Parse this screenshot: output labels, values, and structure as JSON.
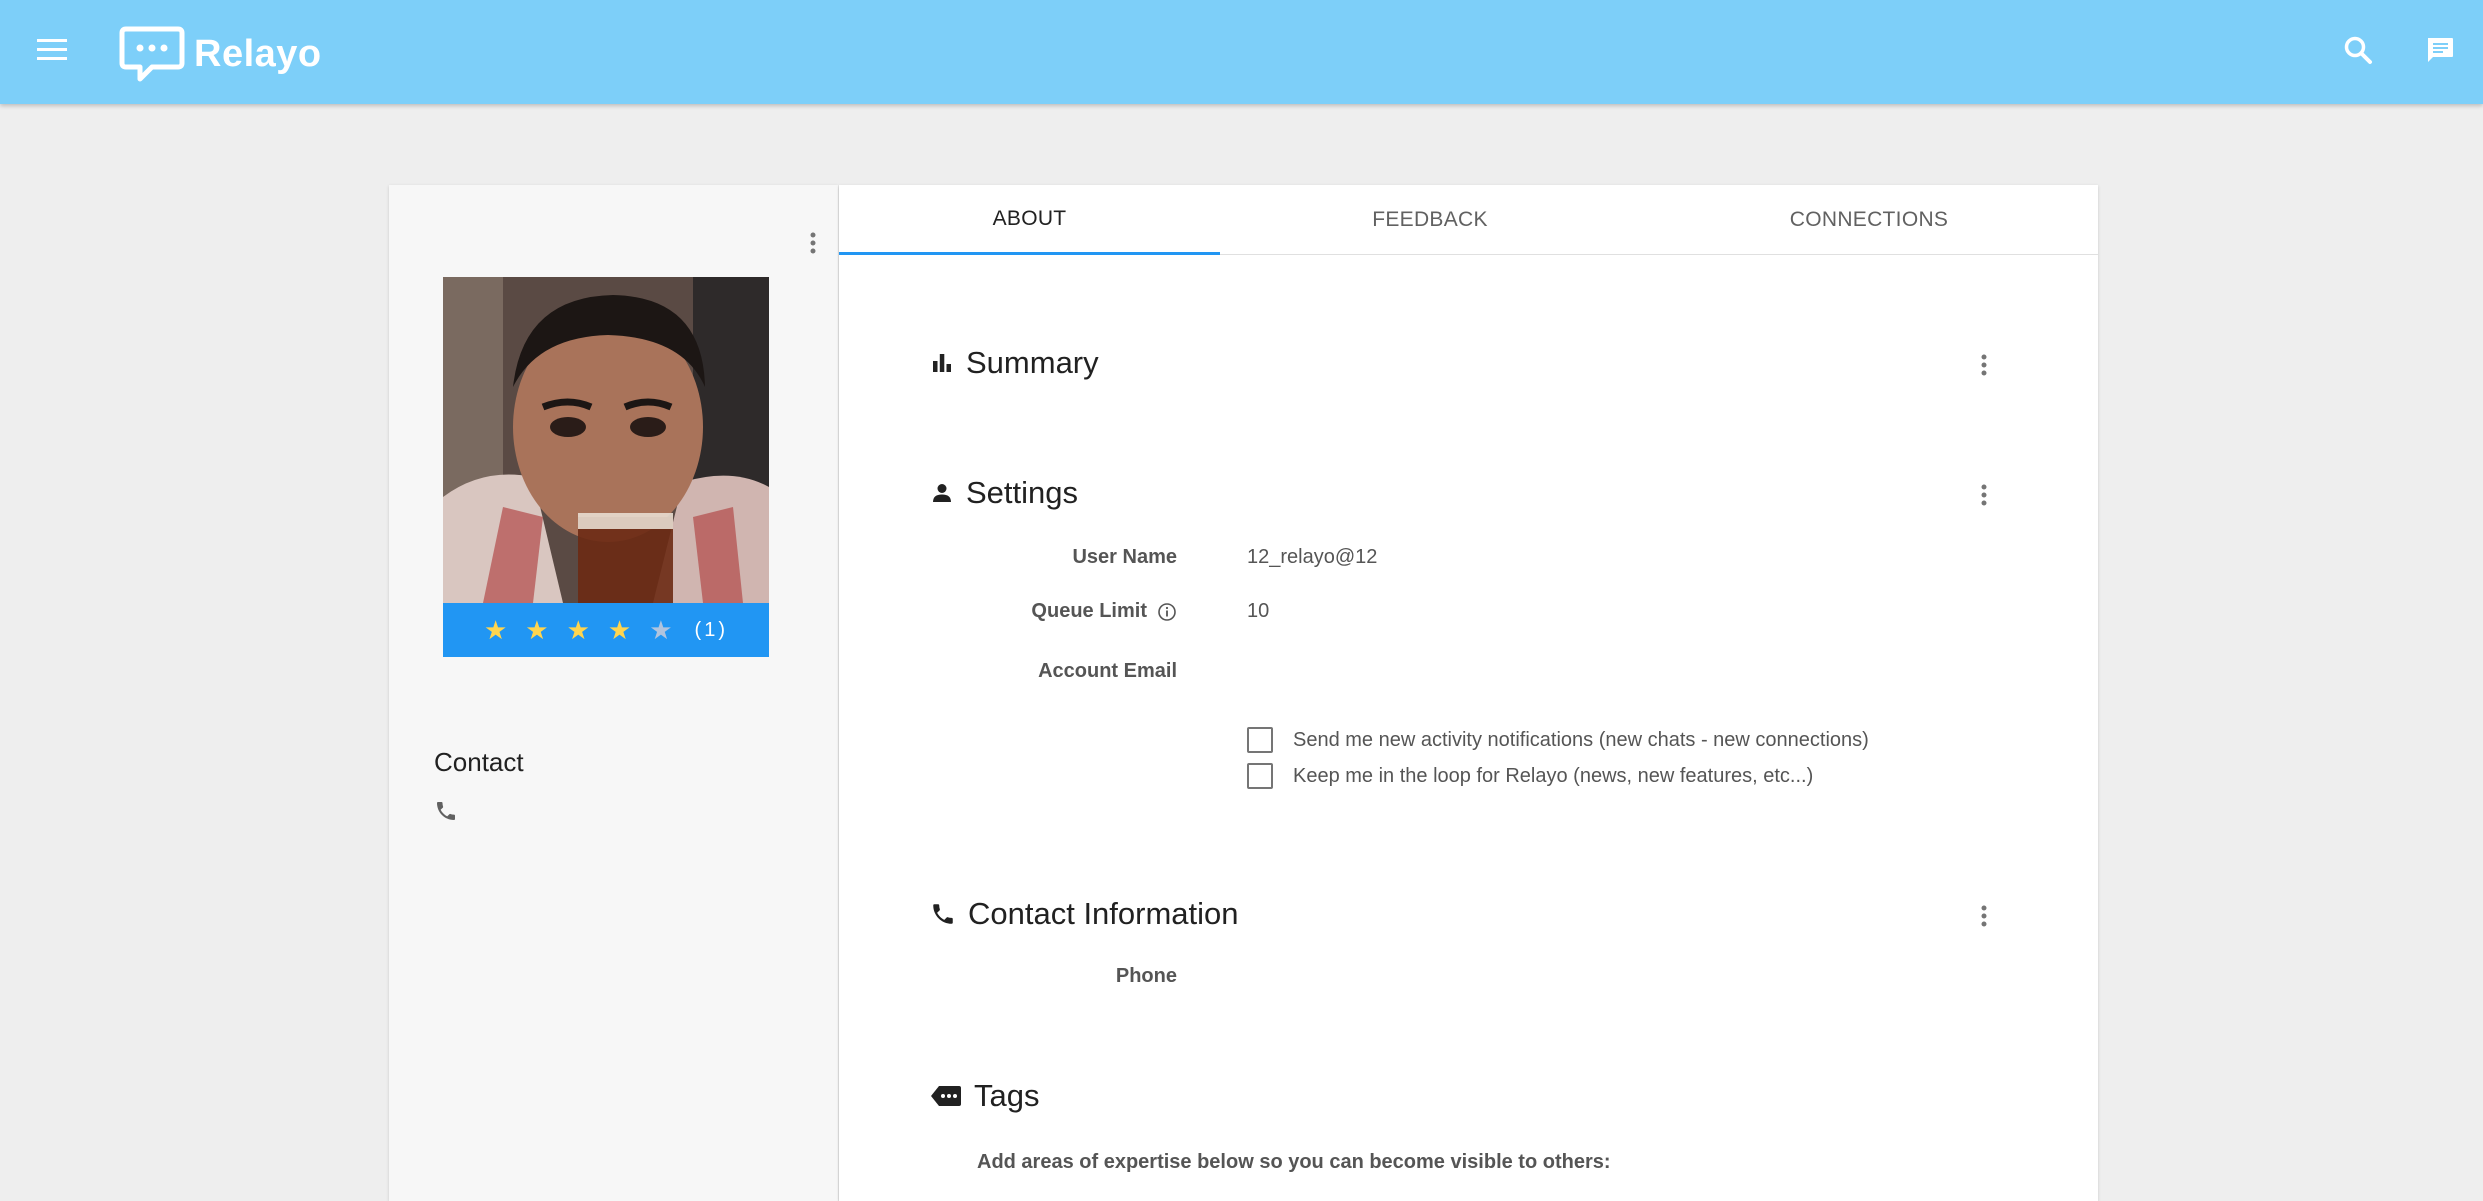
{
  "app": {
    "name": "Relayo"
  },
  "header": {
    "brand_color": "#7dcff9",
    "icons": [
      "menu-icon",
      "relayo-logo-icon",
      "search-icon",
      "chat-icon"
    ]
  },
  "profile": {
    "rating": {
      "stars_filled": 4,
      "stars_total": 5,
      "count_text": "(1)"
    },
    "contact_title": "Contact"
  },
  "tabs": [
    {
      "label": "ABOUT",
      "active": true
    },
    {
      "label": "FEEDBACK",
      "active": false
    },
    {
      "label": "CONNECTIONS",
      "active": false
    }
  ],
  "sections": {
    "summary": {
      "title": "Summary",
      "icon": "bar-chart-icon"
    },
    "settings": {
      "title": "Settings",
      "icon": "person-icon",
      "fields": {
        "user_name": {
          "label": "User Name",
          "value": "12_relayo@12"
        },
        "queue_limit": {
          "label": "Queue Limit",
          "value": "10"
        },
        "account_email": {
          "label": "Account Email",
          "value": ""
        }
      },
      "checkboxes": [
        {
          "label": "Send me new activity notifications (new chats - new connections)",
          "checked": false
        },
        {
          "label": "Keep me in the loop for Relayo (news, new features, etc...)",
          "checked": false
        }
      ]
    },
    "contact_information": {
      "title": "Contact Information",
      "icon": "phone-icon",
      "fields": {
        "phone": {
          "label": "Phone",
          "value": ""
        }
      }
    },
    "tags": {
      "title": "Tags",
      "icon": "tag-icon",
      "hint": "Add areas of expertise below so you can become visible to others:"
    }
  },
  "colors": {
    "accent": "#2196f3",
    "star": "#ffd54f",
    "background": "#eeeeee"
  }
}
